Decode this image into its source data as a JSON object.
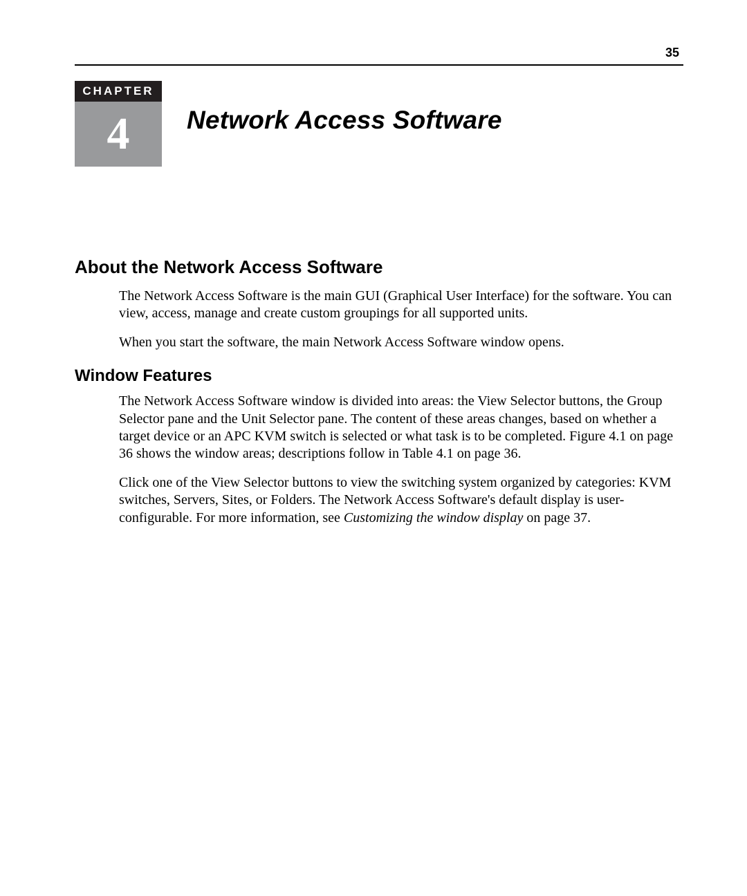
{
  "page_number": "35",
  "chapter": {
    "label": "CHAPTER",
    "number": "4",
    "title": "Network Access Software"
  },
  "section": {
    "heading": "About the Network Access Software",
    "para1": "The Network Access Software is the main GUI (Graphical User Interface) for the software. You can view, access, manage and create custom groupings for all supported units.",
    "para2": "When you start the software, the main Network Access Software window opens."
  },
  "subsection": {
    "heading": "Window Features",
    "para1": "The Network Access Software window is divided into areas: the View Selector buttons, the Group Selector pane and the Unit Selector pane. The content of these areas changes, based on whether a target device or an APC KVM switch is selected or what task is to be completed. Figure 4.1 on page 36 shows the window areas; descriptions follow in Table 4.1 on page 36.",
    "para2_pre": "Click one of the View Selector buttons to view the switching system organized by categories: KVM switches, Servers, Sites, or Folders. The Network Access Software's default display is user-configurable. For more information, see ",
    "para2_italic": "Customizing the window display",
    "para2_post": " on page 37."
  }
}
